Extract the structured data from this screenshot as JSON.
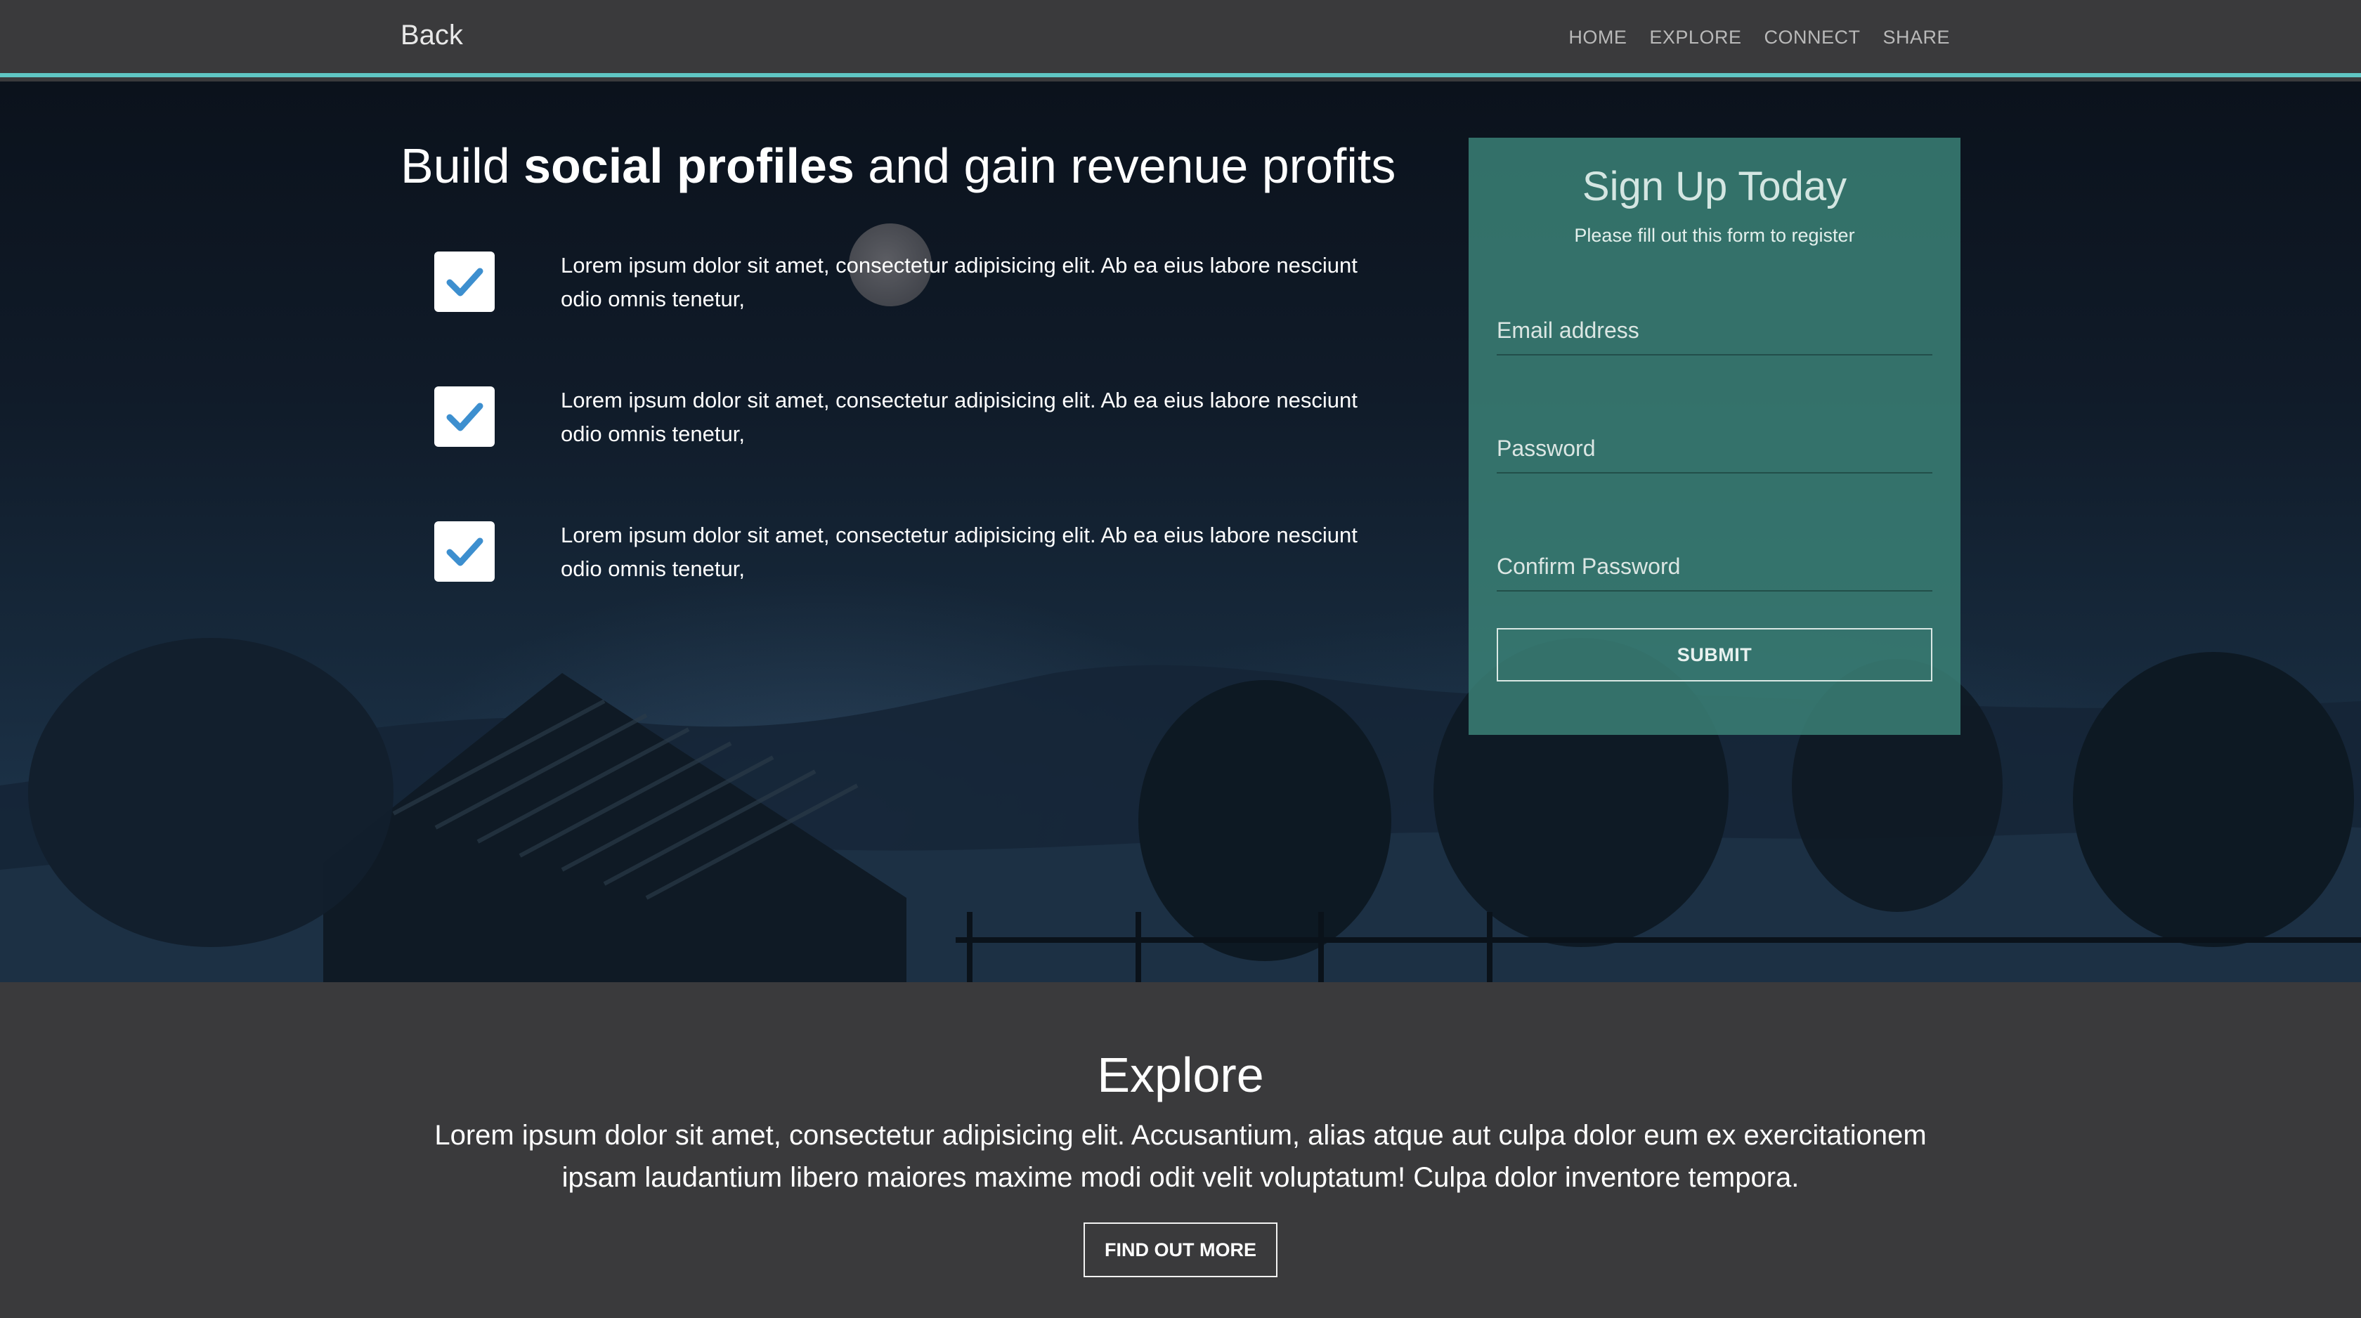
{
  "navbar": {
    "brand": "Back",
    "links": [
      "HOME",
      "EXPLORE",
      "CONNECT",
      "SHARE"
    ]
  },
  "hero": {
    "title_part1": "Build ",
    "title_bold": "social profiles",
    "title_part2": " and gain revenue profits",
    "features": [
      "Lorem ipsum dolor sit amet, consectetur adipisicing elit. Ab ea eius labore nesciunt odio omnis tenetur,",
      "Lorem ipsum dolor sit amet, consectetur adipisicing elit. Ab ea eius labore nesciunt odio omnis tenetur,",
      "Lorem ipsum dolor sit amet, consectetur adipisicing elit. Ab ea eius labore nesciunt odio omnis tenetur,"
    ]
  },
  "signup": {
    "title": "Sign Up Today",
    "subtitle": "Please fill out this form to register",
    "email_placeholder": "Email address",
    "password_placeholder": "Password",
    "confirm_placeholder": "Confirm Password",
    "submit_label": "SUBMIT"
  },
  "explore": {
    "title": "Explore",
    "text": "Lorem ipsum dolor sit amet, consectetur adipisicing elit. Accusantium, alias atque aut culpa dolor eum ex exercitationem ipsam laudantium libero maiores maxime modi odit velit voluptatum! Culpa dolor inventore tempora.",
    "button_label": "FIND OUT MORE"
  },
  "colors": {
    "accent": "#5fc6c4",
    "check": "#3d8fcf",
    "card": "#3a8076",
    "dark_bg": "#3a3a3c"
  }
}
